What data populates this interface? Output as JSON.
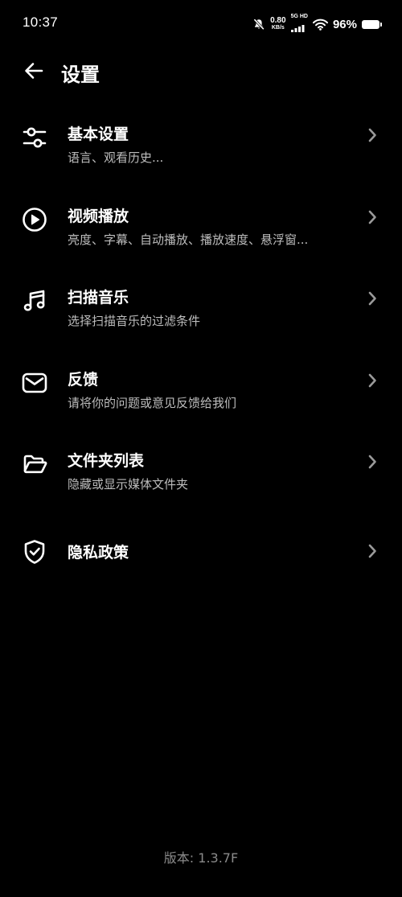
{
  "status_bar": {
    "time": "10:37",
    "net_speed_value": "0.80",
    "net_speed_unit": "KB/s",
    "signal_label": "5G HD",
    "battery_percent": "96%",
    "icons": [
      "mute-icon",
      "signal-icon",
      "wifi-icon",
      "battery-icon"
    ]
  },
  "header": {
    "back_icon": "arrow-left-icon",
    "title": "设置"
  },
  "settings": {
    "items": [
      {
        "icon": "sliders-icon",
        "title": "基本设置",
        "subtitle": "语言、观看历史..."
      },
      {
        "icon": "play-circle-icon",
        "title": "视频播放",
        "subtitle": "亮度、字幕、自动播放、播放速度、悬浮窗..."
      },
      {
        "icon": "music-note-icon",
        "title": "扫描音乐",
        "subtitle": "选择扫描音乐的过滤条件"
      },
      {
        "icon": "mail-icon",
        "title": "反馈",
        "subtitle": "请将你的问题或意见反馈给我们"
      },
      {
        "icon": "folder-open-icon",
        "title": "文件夹列表",
        "subtitle": "隐藏或显示媒体文件夹"
      },
      {
        "icon": "shield-check-icon",
        "title": "隐私政策",
        "subtitle": ""
      }
    ]
  },
  "footer": {
    "version": "版本: 1.3.7F"
  },
  "colors": {
    "background": "#000000",
    "text_primary": "#ffffff",
    "text_secondary": "#bdbdbd",
    "text_muted": "#8a8a8a",
    "chevron": "#9a9a9a"
  }
}
